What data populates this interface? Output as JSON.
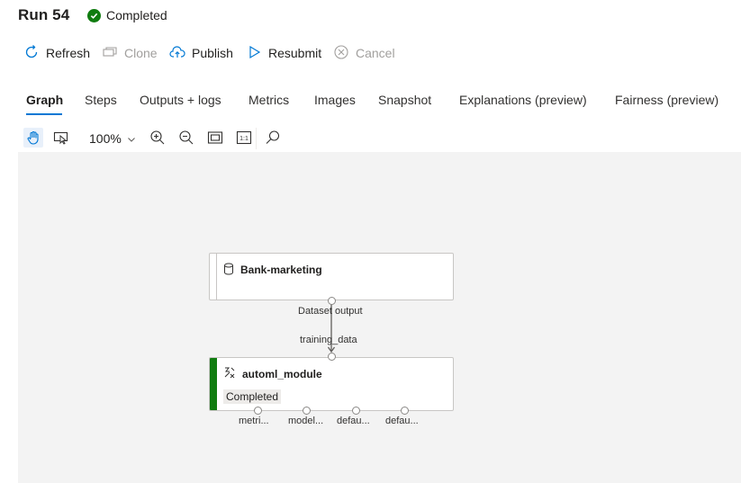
{
  "header": {
    "run_title": "Run 54",
    "status": "Completed",
    "status_color": "#107c10"
  },
  "commands": {
    "refresh": "Refresh",
    "clone": "Clone",
    "publish": "Publish",
    "resubmit": "Resubmit",
    "cancel": "Cancel"
  },
  "tabs": [
    {
      "label": "Graph",
      "active": true
    },
    {
      "label": "Steps"
    },
    {
      "label": "Outputs + logs"
    },
    {
      "label": "Metrics"
    },
    {
      "label": "Images"
    },
    {
      "label": "Snapshot"
    },
    {
      "label": "Explanations (preview)"
    },
    {
      "label": "Fairness (preview)"
    }
  ],
  "toolbar": {
    "zoom": "100%",
    "icons": [
      "pan-hand-icon",
      "select-icon",
      "zoom-in-icon",
      "zoom-out-icon",
      "fit-screen-icon",
      "actual-size-icon",
      "search-icon"
    ],
    "actual_size_label": "1:1"
  },
  "graph": {
    "dataset_node": {
      "title": "Bank-marketing",
      "output_port_label": "Dataset output",
      "icon": "database-icon"
    },
    "module_node": {
      "title": "automl_module",
      "status": "Completed",
      "input_port_label": "training_data",
      "accent_color": "#107c10",
      "icon": "automl-icon",
      "output_ports": [
        "metri...",
        "model...",
        "defau...",
        "defau..."
      ]
    }
  }
}
